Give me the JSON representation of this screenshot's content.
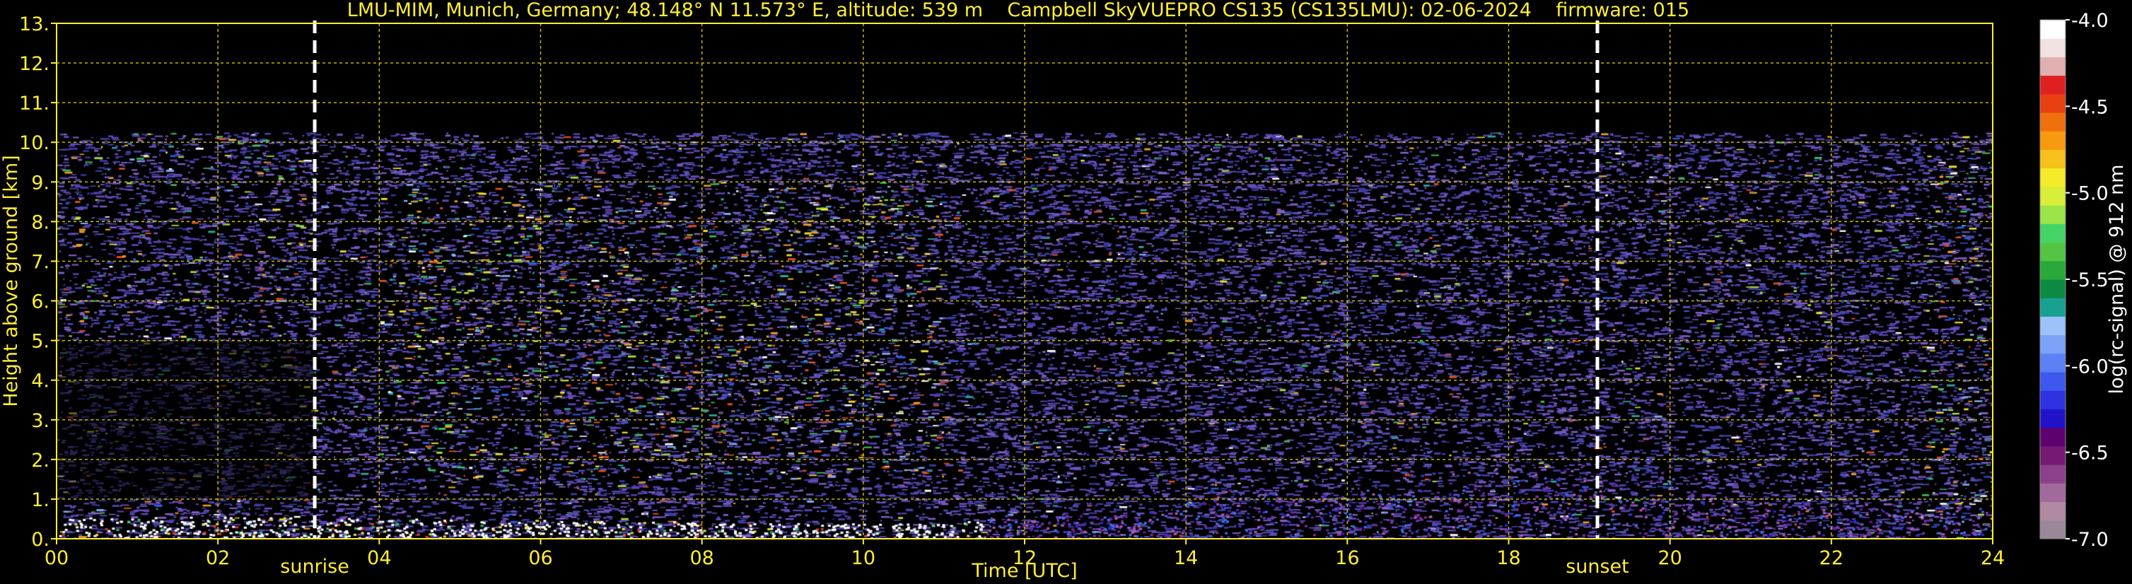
{
  "header": {
    "site": "LMU-MIM, Munich, Germany; 48.148° N 11.573° E, altitude: 539 m",
    "instrument": "Campbell SkyVUEPRO CS135 (CS135LMU): 02-06-2024",
    "firmware": "firmware: 015"
  },
  "colors": {
    "background": "#000000",
    "text": "#ffee33",
    "grid": "#d4c400",
    "sun_lines": "#ffffff",
    "colorbar_text": "#ffffff"
  },
  "chart_data": {
    "type": "heatmap",
    "xlabel": "Time [UTC]",
    "ylabel": "Height above ground [km]",
    "xlim": [
      0,
      24
    ],
    "ylim": [
      0,
      13
    ],
    "xticks": [
      "00",
      "02",
      "04",
      "06",
      "08",
      "10",
      "12",
      "14",
      "16",
      "18",
      "20",
      "22",
      "24"
    ],
    "yticks": [
      "0.",
      "1.",
      "2.",
      "3.",
      "4.",
      "5.",
      "6.",
      "7.",
      "8.",
      "9.",
      "10.",
      "11.",
      "12.",
      "13."
    ],
    "grid": true,
    "annotations": [
      {
        "label": "sunrise",
        "x": 3.2
      },
      {
        "label": "sunset",
        "x": 19.1
      }
    ],
    "signal_top_km": 10.25,
    "colorbar": {
      "label": "log(rc-signal) @ 912 nm",
      "range": [
        -7.0,
        -4.0
      ],
      "ticks": [
        "-4.0",
        "-4.5",
        "-5.0",
        "-5.5",
        "-6.0",
        "-6.5",
        "-7.0"
      ],
      "colors": [
        "#9a8898",
        "#b089a3",
        "#a26a9c",
        "#8c3f8a",
        "#751a74",
        "#5f0070",
        "#1f12c8",
        "#2e32e0",
        "#3e58ee",
        "#5c80f5",
        "#7aa2f7",
        "#9dc1f9",
        "#18a090",
        "#0c8a44",
        "#2aa83a",
        "#55c444",
        "#44d468",
        "#9be44a",
        "#d8ee3a",
        "#f4ec2a",
        "#f7c01a",
        "#f79a10",
        "#f07010",
        "#e84010",
        "#e02020",
        "#e0b0b0",
        "#f2e2e2",
        "#ffffff"
      ]
    }
  }
}
